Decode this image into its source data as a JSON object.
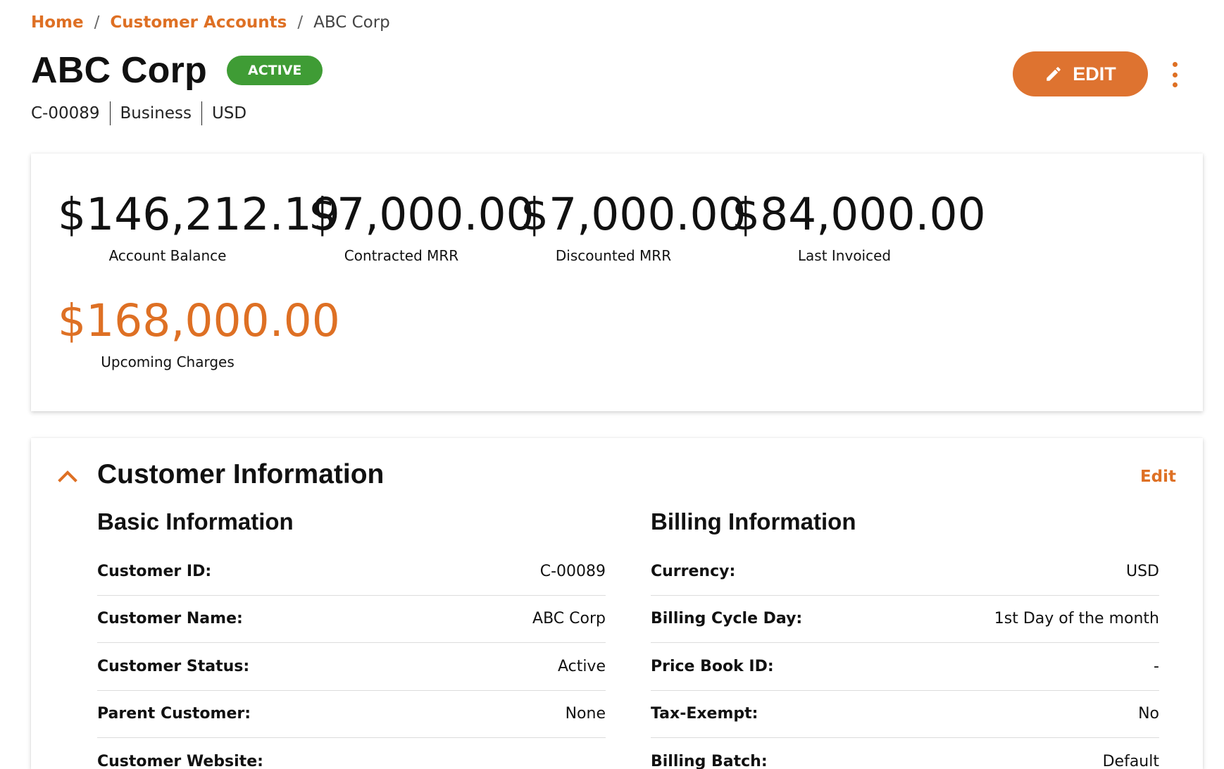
{
  "breadcrumb": {
    "home": "Home",
    "customer_accounts": "Customer Accounts",
    "current": "ABC Corp",
    "separator": "/"
  },
  "header": {
    "title": "ABC Corp",
    "status": "ACTIVE",
    "meta": [
      "C-00089",
      "Business",
      "USD"
    ],
    "edit_label": "EDIT",
    "edit_icon": "pencil-icon",
    "more_icon": "more-vertical-icon"
  },
  "summary": {
    "metrics": [
      {
        "value": "$146,212.19",
        "label": "Account Balance"
      },
      {
        "value": "$7,000.00",
        "label": "Contracted MRR"
      },
      {
        "value": "$7,000.00",
        "label": "Discounted MRR"
      },
      {
        "value": "$84,000.00",
        "label": "Last Invoiced"
      },
      {
        "value": "$168,000.00",
        "label": "Upcoming Charges"
      }
    ]
  },
  "customer_info": {
    "title": "Customer Information",
    "edit_link": "Edit",
    "collapse_icon": "chevron-up-icon",
    "basic": {
      "title": "Basic Information",
      "rows": [
        {
          "label": "Customer ID:",
          "value": "C-00089"
        },
        {
          "label": "Customer Name:",
          "value": "ABC Corp"
        },
        {
          "label": "Customer Status:",
          "value": "Active"
        },
        {
          "label": "Parent Customer:",
          "value": "None"
        },
        {
          "label": "Customer Website:",
          "value": ""
        }
      ]
    },
    "billing": {
      "title": "Billing Information",
      "rows": [
        {
          "label": "Currency:",
          "value": "USD"
        },
        {
          "label": "Billing Cycle Day:",
          "value": "1st Day of the month"
        },
        {
          "label": "Price Book ID:",
          "value": "-"
        },
        {
          "label": "Tax-Exempt:",
          "value": "No"
        },
        {
          "label": "Billing Batch:",
          "value": "Default"
        }
      ]
    }
  },
  "colors": {
    "accent": "#de7024",
    "active_badge": "#3f9c35",
    "edit_button": "#de7330"
  }
}
